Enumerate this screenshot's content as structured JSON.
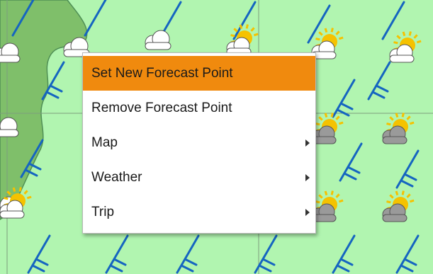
{
  "map": {
    "colors": {
      "field": "#b1f5b0",
      "land": "#7fbf6a",
      "land_edge": "#4f8f55",
      "grid": "#7d9d7d",
      "wind_barb": "#1565c0",
      "cloud": "#ffffff",
      "cloud_dark": "#9a9a9a",
      "sun": "#f5c200"
    },
    "icons": [
      "wind-barb-icon",
      "cloud-icon",
      "partly-cloudy-icon",
      "sun-icon"
    ]
  },
  "context_menu": {
    "items": [
      {
        "label": "Set New Forecast Point",
        "highlighted": true,
        "submenu": false
      },
      {
        "label": "Remove Forecast Point",
        "highlighted": false,
        "submenu": false
      },
      {
        "label": "Map",
        "highlighted": false,
        "submenu": true
      },
      {
        "label": "Weather",
        "highlighted": false,
        "submenu": true
      },
      {
        "label": "Trip",
        "highlighted": false,
        "submenu": true
      }
    ],
    "highlight_color": "#f08a0e"
  }
}
